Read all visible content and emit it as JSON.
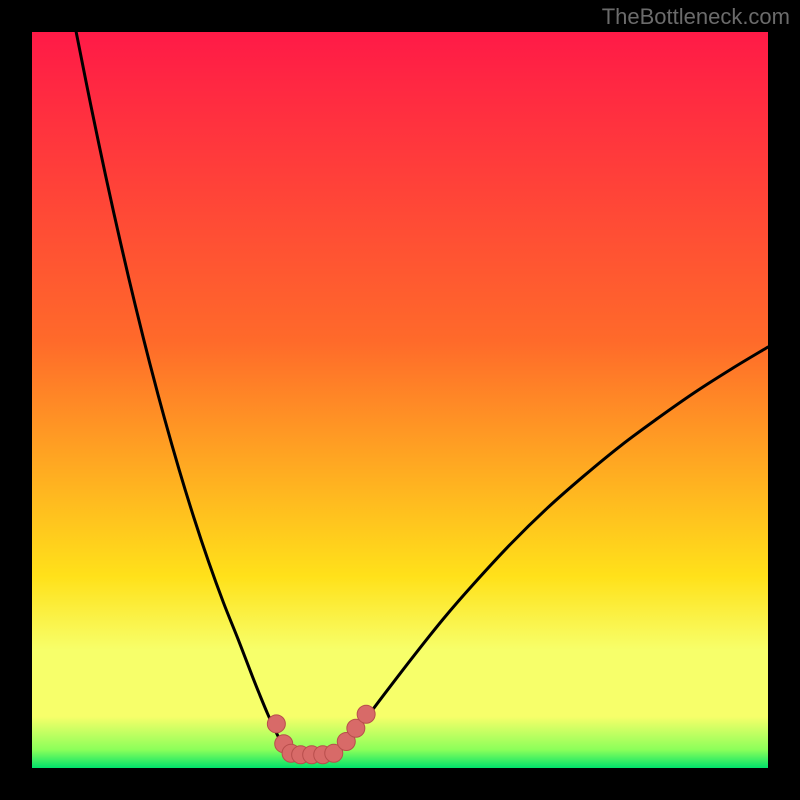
{
  "watermark": "TheBottleneck.com",
  "colors": {
    "gradient_top": "#ff1a47",
    "gradient_mid1": "#ff6a2a",
    "gradient_mid2": "#ffe11a",
    "gradient_bottom_band": "#f7ff6a",
    "gradient_green": "#00e26a",
    "frame_bg": "#000000",
    "curve": "#000000",
    "marker_fill": "#d86a68",
    "marker_stroke": "#b84e4c"
  },
  "chart_data": {
    "type": "line",
    "title": "",
    "xlabel": "",
    "ylabel": "",
    "xlim": [
      0,
      100
    ],
    "ylim": [
      0,
      100
    ],
    "grid": false,
    "legend": false,
    "series": [
      {
        "name": "left-curve",
        "x": [
          6,
          8,
          10,
          12,
          14,
          16,
          18,
          20,
          22,
          24,
          26,
          28,
          30,
          31,
          32,
          33,
          34,
          34.6
        ],
        "y": [
          100,
          90,
          80.5,
          71.5,
          63,
          55,
          47.5,
          40.5,
          34,
          28,
          22.5,
          17.5,
          12.3,
          9.8,
          7.4,
          5.2,
          3.2,
          2.0
        ]
      },
      {
        "name": "right-curve",
        "x": [
          41.5,
          43,
          45,
          48,
          52,
          56,
          60,
          65,
          70,
          75,
          80,
          85,
          90,
          95,
          100
        ],
        "y": [
          2.0,
          3.5,
          6.2,
          10.2,
          15.4,
          20.4,
          25.0,
          30.4,
          35.3,
          39.7,
          43.8,
          47.5,
          51.0,
          54.2,
          57.2
        ]
      },
      {
        "name": "bottom-flat",
        "x": [
          34.6,
          36,
          38,
          40,
          41.5
        ],
        "y": [
          2.0,
          1.8,
          1.8,
          1.8,
          2.0
        ]
      }
    ],
    "markers": [
      {
        "x": 33.2,
        "y": 6.0
      },
      {
        "x": 34.2,
        "y": 3.3
      },
      {
        "x": 35.2,
        "y": 2.0
      },
      {
        "x": 36.5,
        "y": 1.8
      },
      {
        "x": 38.0,
        "y": 1.8
      },
      {
        "x": 39.5,
        "y": 1.8
      },
      {
        "x": 41.0,
        "y": 2.0
      },
      {
        "x": 42.7,
        "y": 3.6
      },
      {
        "x": 44.0,
        "y": 5.4
      },
      {
        "x": 45.4,
        "y": 7.3
      }
    ]
  }
}
